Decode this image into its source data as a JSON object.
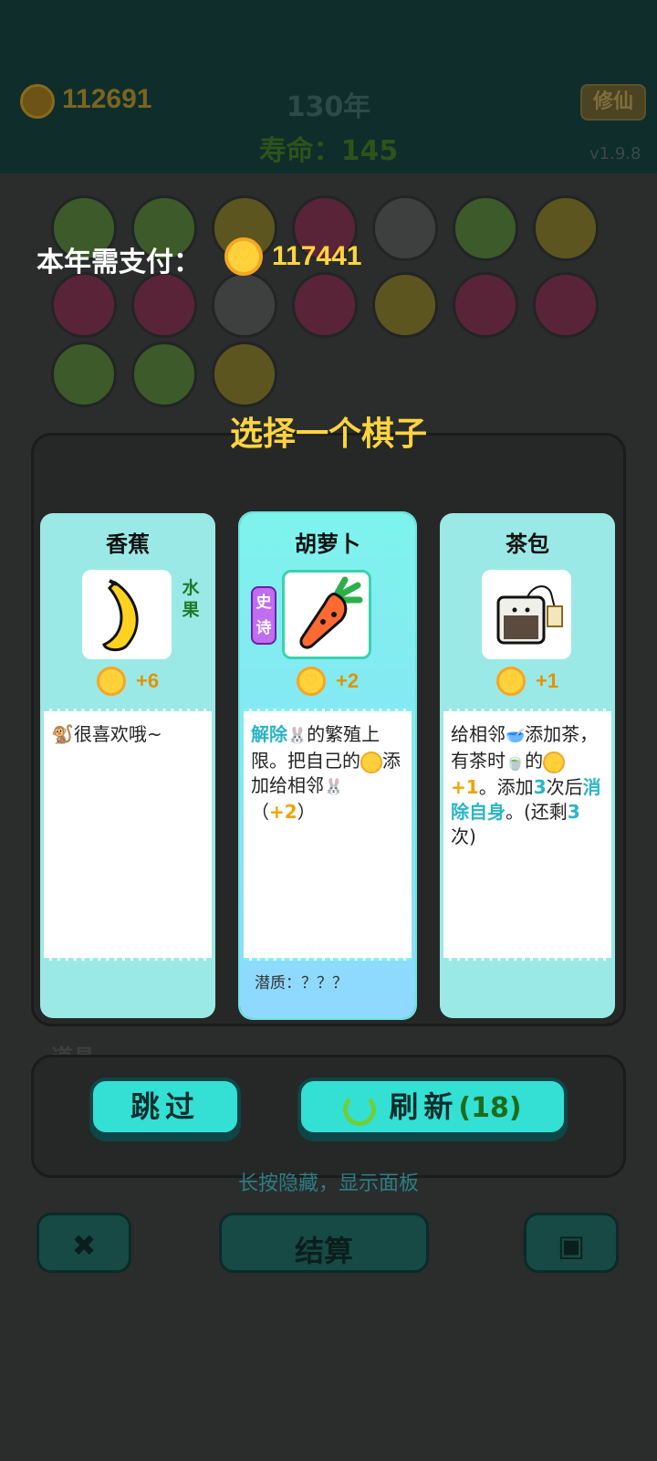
{
  "header": {
    "gold": "112691",
    "year": "130年",
    "lifespan": "寿命：145",
    "cultivate_button": "修仙",
    "version": "v1.9.8"
  },
  "payment": {
    "label": "本年需支付：",
    "amount": "117441"
  },
  "choose_title": "选择一个棋子",
  "cards": [
    {
      "name": "香蕉",
      "tag": "水果",
      "value": "+6",
      "desc": "🐒很喜欢哦~"
    },
    {
      "name": "胡萝卜",
      "rarity": "史诗",
      "value": "+2",
      "desc_parts": {
        "a": "解除",
        "b": "的繁殖上限。把自己的",
        "c": "添加给相邻",
        "d": "（",
        "e": "+2",
        "f": "）"
      },
      "potential": "潜质：？？？"
    },
    {
      "name": "茶包",
      "value": "+1",
      "desc_parts": {
        "a": "给相邻",
        "b": "添加茶，有茶时",
        "c": "的",
        "d": "+1",
        "e": "。添加",
        "f": "3",
        "g": "次后",
        "h": "消除自身",
        "i": "。(还剩",
        "j": "3",
        "k": "次)"
      }
    }
  ],
  "actions": {
    "skip": "跳过",
    "refresh": "刷新",
    "refresh_count": "(18)"
  },
  "hint": "长按隐藏，显示面板",
  "background": {
    "tools_label": "道具",
    "settle_button": "结算"
  },
  "colors": {
    "accent": "#33e0d3",
    "gold": "#ffd43f",
    "epic": "#c16df0"
  }
}
